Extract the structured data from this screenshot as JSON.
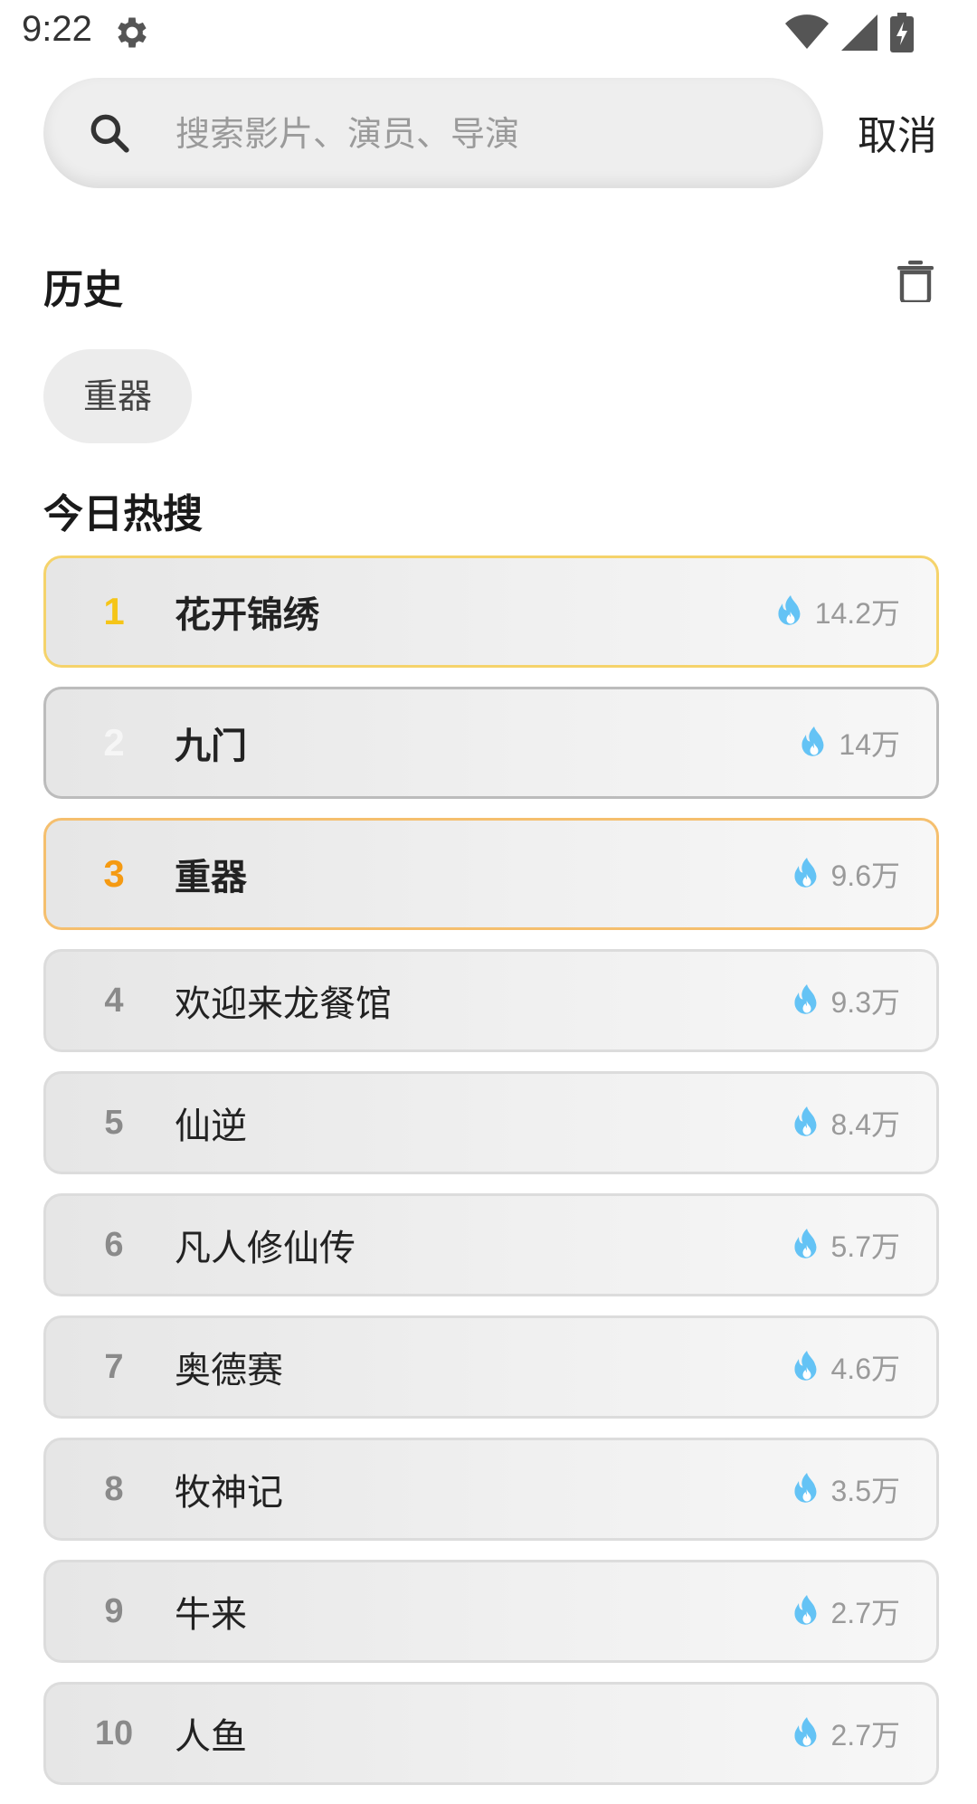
{
  "status_bar": {
    "time": "9:22",
    "icons": [
      "gear-icon",
      "wifi-icon",
      "signal-icon",
      "battery-charging-icon"
    ]
  },
  "search": {
    "placeholder": "搜索影片、演员、导演",
    "value": "",
    "cancel_label": "取消",
    "icon": "search-icon"
  },
  "history": {
    "title": "历史",
    "clear_icon": "trash-icon",
    "items": [
      {
        "label": "重器"
      }
    ]
  },
  "hot": {
    "title": "今日热搜",
    "heat_icon": "fire-icon",
    "accent_colors": {
      "rank1": "#f5c518",
      "rank2": "#f6f6f6",
      "rank3": "#f59a12",
      "fire": "#64c3f5"
    },
    "items": [
      {
        "rank": "1",
        "title": "花开锦绣",
        "heat": "14.2万"
      },
      {
        "rank": "2",
        "title": "九门",
        "heat": "14万"
      },
      {
        "rank": "3",
        "title": "重器",
        "heat": "9.6万"
      },
      {
        "rank": "4",
        "title": "欢迎来龙餐馆",
        "heat": "9.3万"
      },
      {
        "rank": "5",
        "title": "仙逆",
        "heat": "8.4万"
      },
      {
        "rank": "6",
        "title": "凡人修仙传",
        "heat": "5.7万"
      },
      {
        "rank": "7",
        "title": "奥德赛",
        "heat": "4.6万"
      },
      {
        "rank": "8",
        "title": "牧神记",
        "heat": "3.5万"
      },
      {
        "rank": "9",
        "title": "牛来",
        "heat": "2.7万"
      },
      {
        "rank": "10",
        "title": "人鱼",
        "heat": "2.7万"
      }
    ]
  }
}
